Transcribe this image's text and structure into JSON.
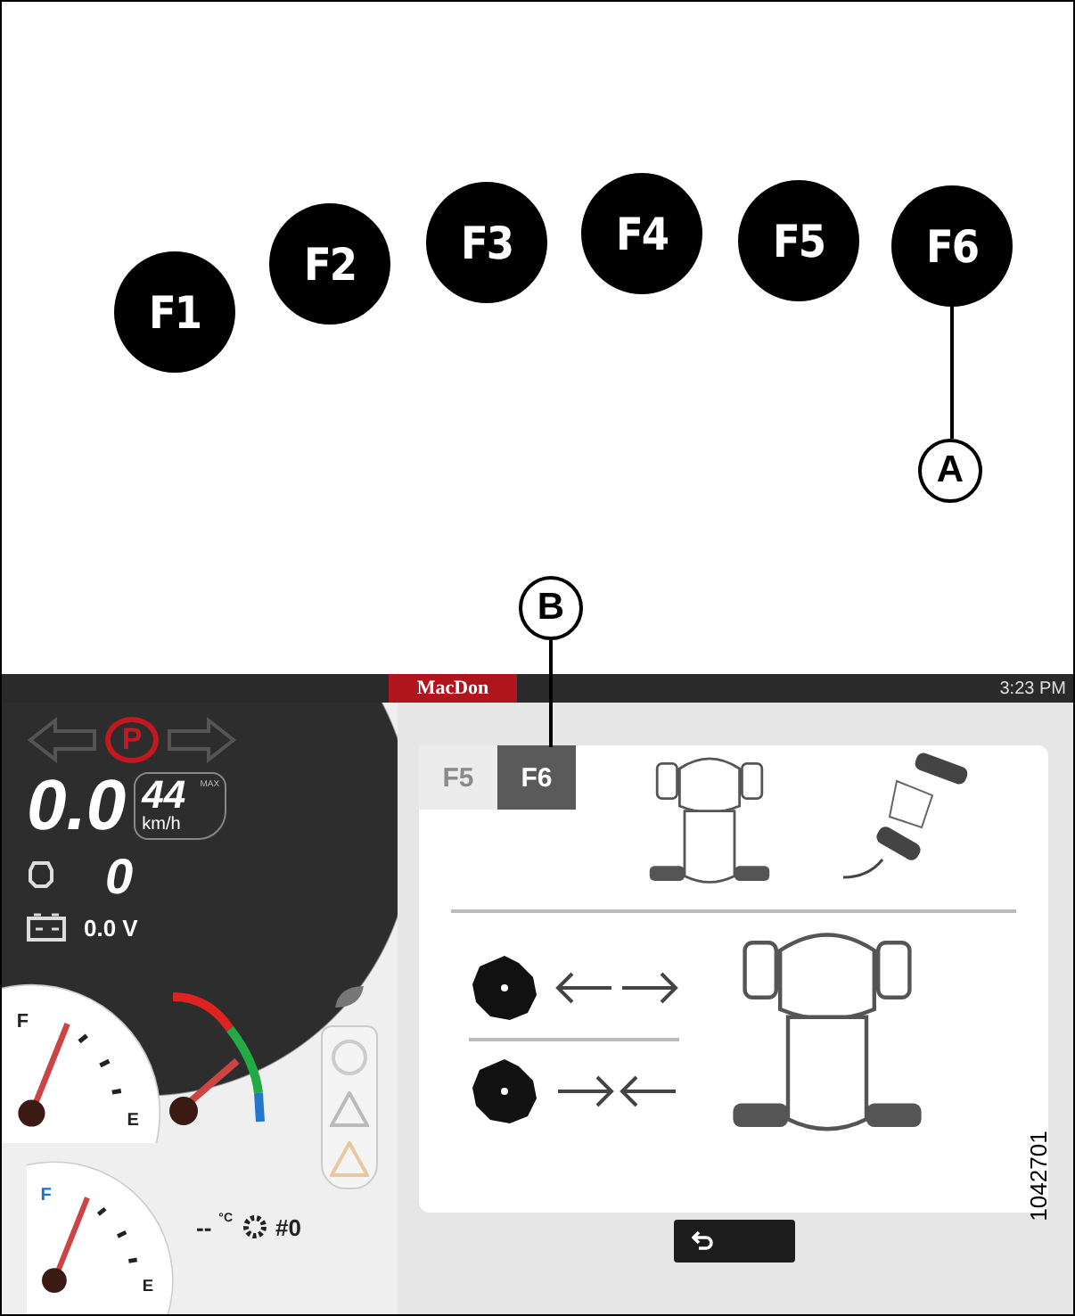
{
  "keys": [
    {
      "label": "F1"
    },
    {
      "label": "F2"
    },
    {
      "label": "F3"
    },
    {
      "label": "F4"
    },
    {
      "label": "F5"
    },
    {
      "label": "F6"
    }
  ],
  "callouts": [
    {
      "label": "A"
    },
    {
      "label": "B"
    }
  ],
  "display": {
    "logo": "MacDon",
    "time": "3:23 PM",
    "parking_symbol": "P",
    "speed": "0.0",
    "max_speed": "44",
    "max_label": "MAX",
    "speed_unit": "km/h",
    "engine_value": "0",
    "voltage": "0.0 V",
    "fuel_gauge": {
      "full": "F",
      "empty": "E"
    },
    "def_gauge": {
      "full": "F",
      "empty": "E"
    },
    "temperature": "--",
    "temperature_unit": "°C",
    "gear": "#0",
    "tabs": [
      {
        "label": "F5",
        "selected": false
      },
      {
        "label": "F6",
        "selected": true
      }
    ]
  },
  "figure_number": "1042701"
}
